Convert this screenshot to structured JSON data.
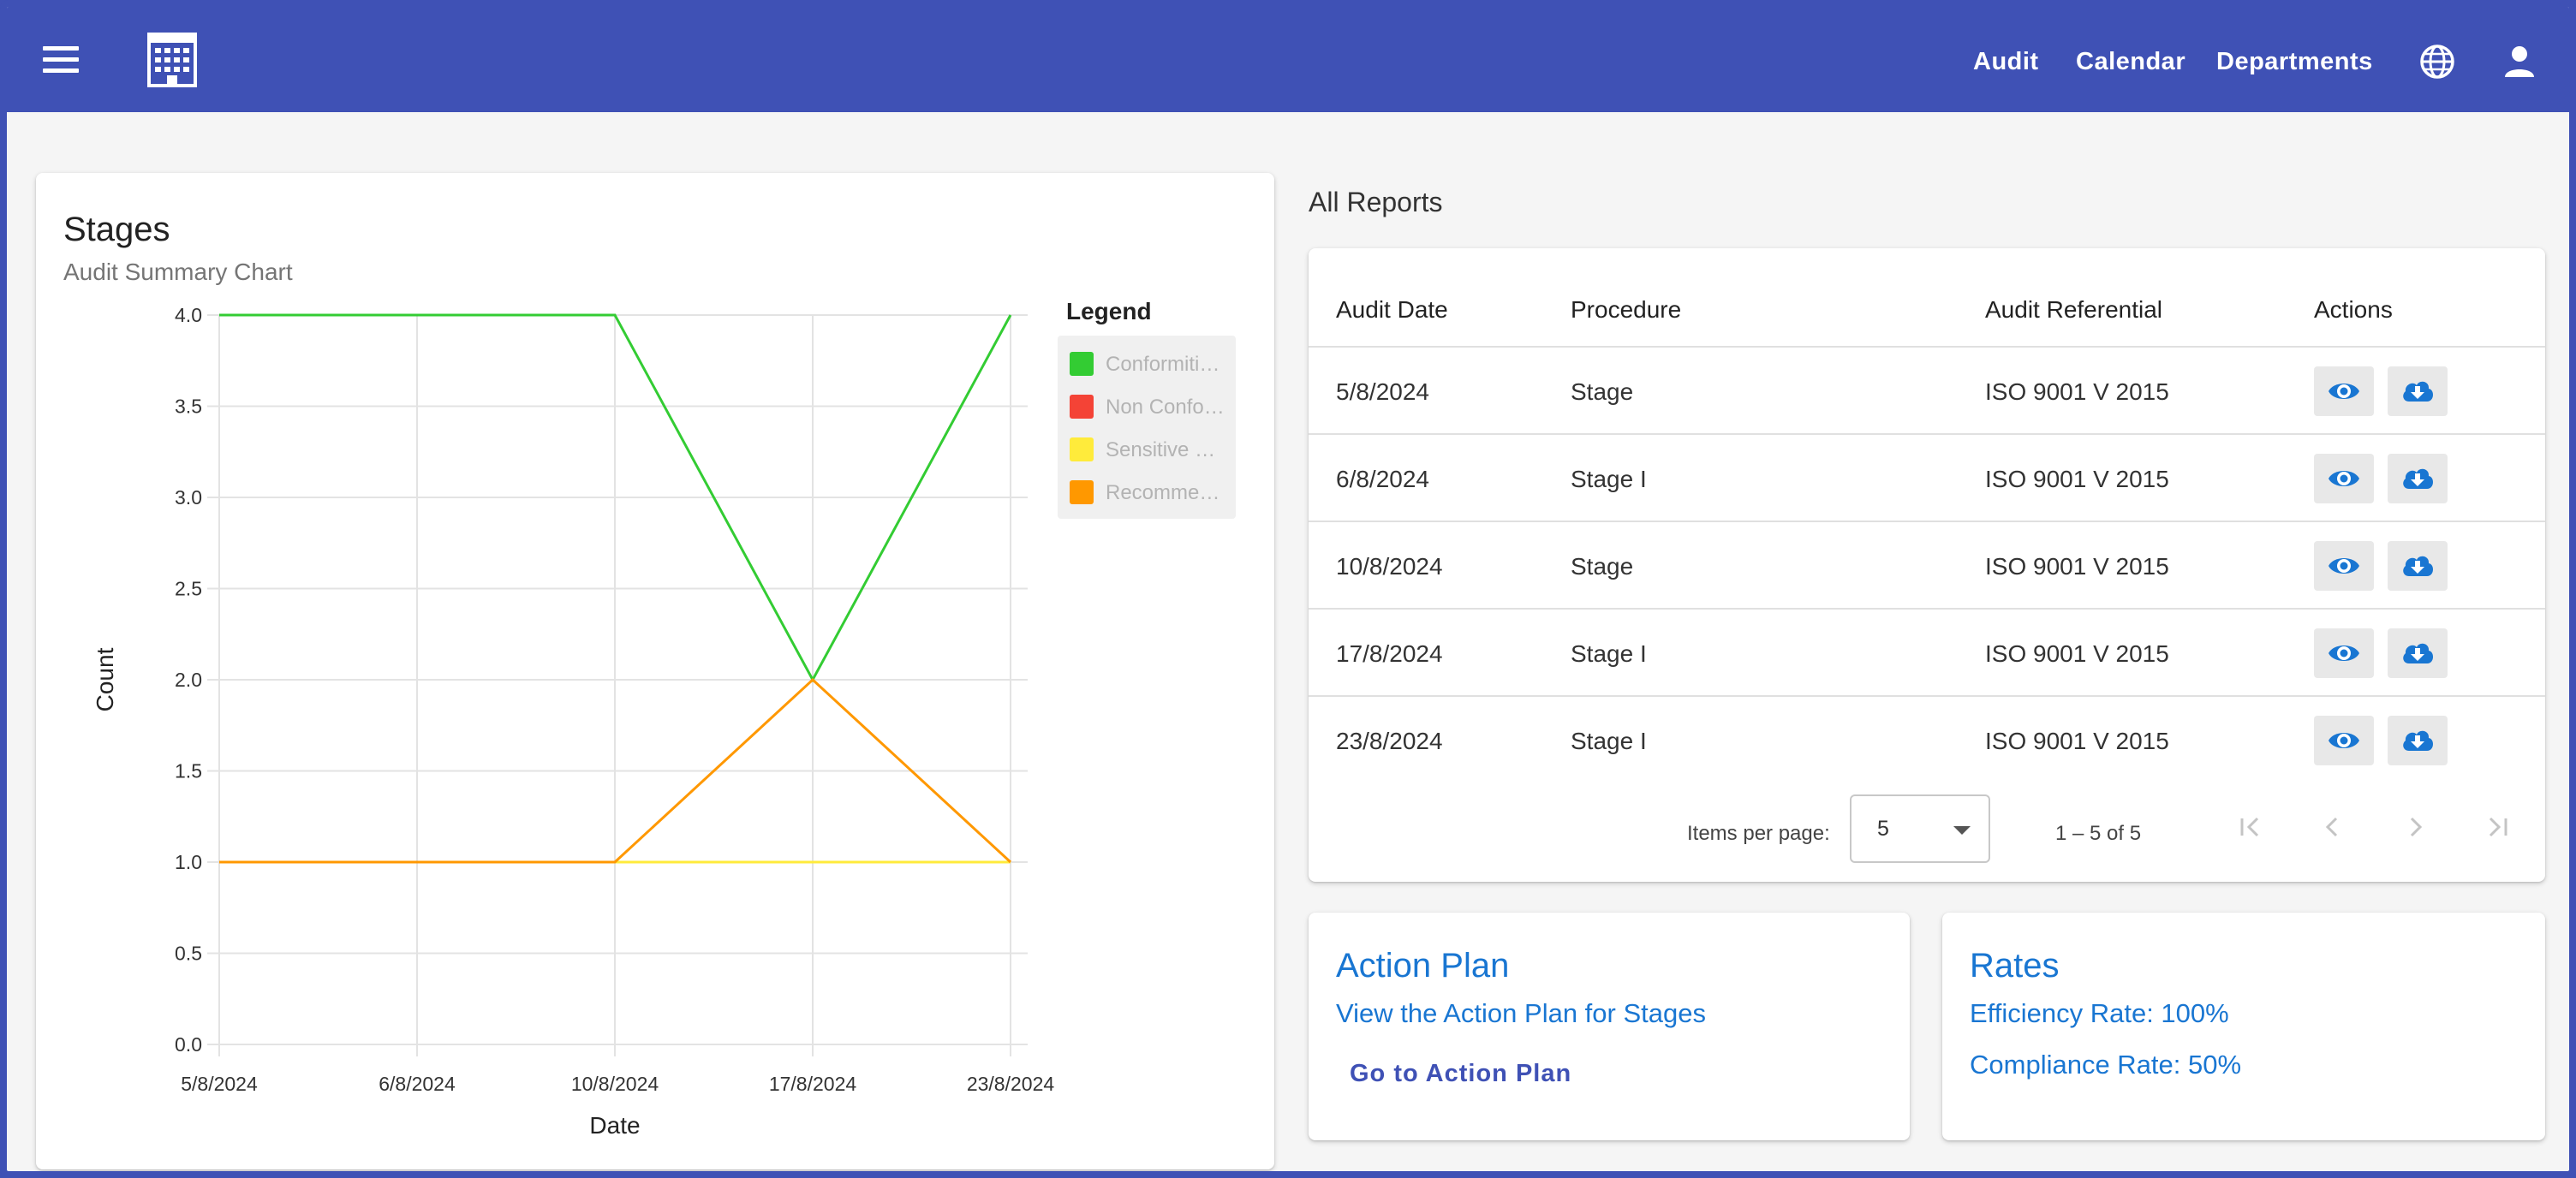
{
  "topbar": {
    "nav": [
      "Audit",
      "Calendar",
      "Departments"
    ],
    "menu_icon": "menu-icon",
    "logo_icon": "building-logo-icon",
    "language_icon": "globe-icon",
    "account_icon": "person-icon"
  },
  "chart_panel": {
    "title": "Stages",
    "subtitle": "Audit Summary Chart",
    "legend_title": "Legend"
  },
  "chart_data": {
    "type": "line",
    "categories": [
      "5/8/2024",
      "6/8/2024",
      "10/8/2024",
      "17/8/2024",
      "23/8/2024"
    ],
    "series": [
      {
        "name": "Conformiti…",
        "color": "#33cc33",
        "values": [
          4,
          4,
          4,
          2,
          4
        ]
      },
      {
        "name": "Non Confo…",
        "color": "#f44336",
        "values": [
          1,
          1,
          1,
          1,
          1
        ]
      },
      {
        "name": "Sensitive P…",
        "color": "#ffeb3b",
        "values": [
          1,
          1,
          1,
          1,
          1
        ]
      },
      {
        "name": "Recomme…",
        "color": "#ff9800",
        "values": [
          1,
          1,
          1,
          2,
          1
        ]
      }
    ],
    "xlabel": "Date",
    "ylabel": "Count",
    "ylim": [
      0,
      4
    ],
    "yticks": [
      "0.0",
      "0.5",
      "1.0",
      "1.5",
      "2.0",
      "2.5",
      "3.0",
      "3.5",
      "4.0"
    ],
    "grid": true,
    "legend_position": "right"
  },
  "reports": {
    "label": "All Reports",
    "columns": [
      "Audit Date",
      "Procedure",
      "Audit Referential",
      "Actions"
    ],
    "rows": [
      {
        "date": "5/8/2024",
        "procedure": "Stage",
        "referential": "ISO 9001 V 2015"
      },
      {
        "date": "6/8/2024",
        "procedure": "Stage I",
        "referential": "ISO 9001 V 2015"
      },
      {
        "date": "10/8/2024",
        "procedure": "Stage",
        "referential": "ISO 9001 V 2015"
      },
      {
        "date": "17/8/2024",
        "procedure": "Stage I",
        "referential": "ISO 9001 V 2015"
      },
      {
        "date": "23/8/2024",
        "procedure": "Stage I",
        "referential": "ISO 9001 V 2015"
      }
    ],
    "view_icon": "eye-icon",
    "download_icon": "cloud-download-icon",
    "pagination": {
      "items_label": "Items per page:",
      "page_size": "5",
      "range": "1 – 5 of 5"
    }
  },
  "action_plan": {
    "title": "Action Plan",
    "link": "View the Action Plan for Stages",
    "button": "Go to Action Plan"
  },
  "rates": {
    "title": "Rates",
    "efficiency": "Efficiency Rate: 100%",
    "compliance": "Compliance Rate: 50%"
  },
  "colors": {
    "primary": "#3f51b5",
    "accent": "#1976d2",
    "background": "#f5f5f5"
  }
}
